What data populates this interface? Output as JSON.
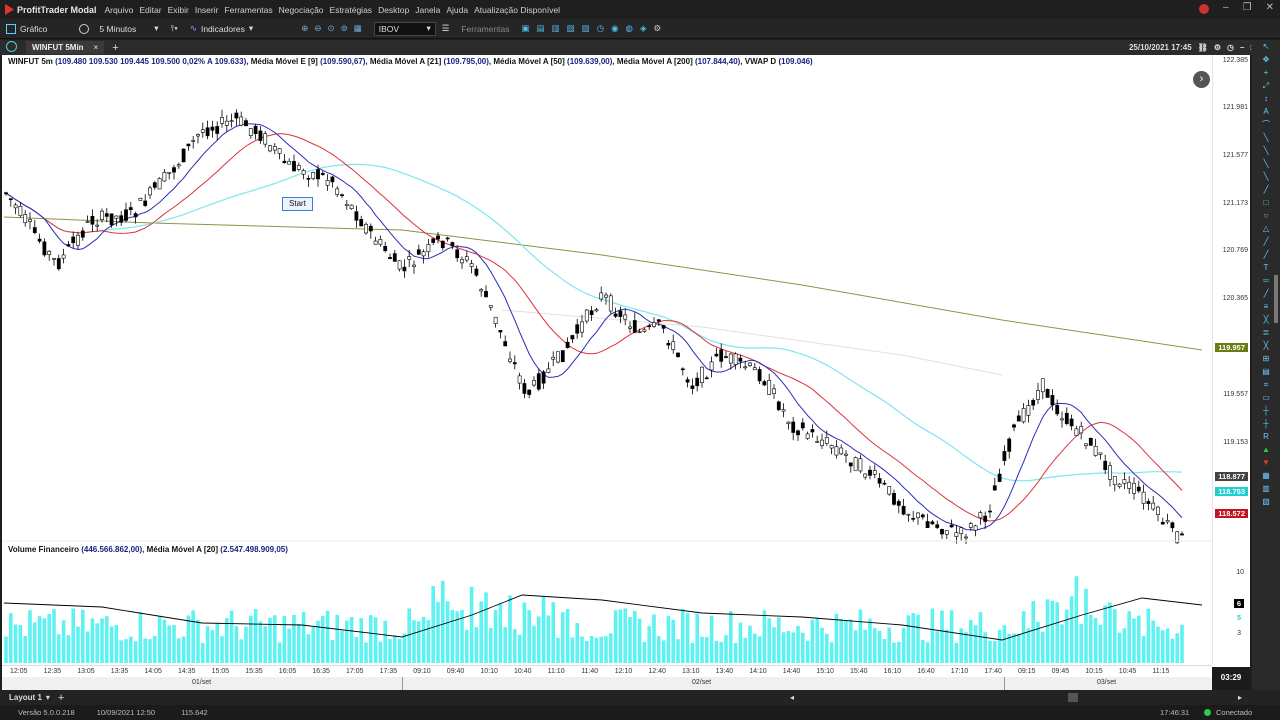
{
  "app": {
    "title": "ProfitTrader Modal",
    "menu": [
      "Arquivo",
      "Editar",
      "Exibir",
      "Inserir",
      "Ferramentas",
      "Negociação",
      "Estratégias",
      "Desktop",
      "Janela",
      "Ajuda",
      "Atualização Disponível"
    ]
  },
  "toolbar": {
    "chart_label": "Gráfico",
    "interval": "5 Minutos",
    "indicators_label": "Indicadores",
    "symbol": "IBOV",
    "tools_label": "Ferramentas"
  },
  "tab": {
    "name": "WINFUT 5Min",
    "datetime": "25/10/2021 17:45"
  },
  "chart": {
    "header": "WINFUT 5m",
    "quote": "(109.480  109.530  109.445  109.500  0,02%  A 109.633),",
    "indicators": [
      {
        "name": "Média Móvel E [9]",
        "value": "(109.590,67),"
      },
      {
        "name": "Média Móvel A [21]",
        "value": "(109.795,00),"
      },
      {
        "name": "Média Móvel A [50]",
        "value": "(109.639,00),"
      },
      {
        "name": "Média Móvel A [200]",
        "value": "(107.844,40),"
      },
      {
        "name": "VWAP D",
        "value": "(109.046)"
      }
    ],
    "volume_title": "Volume Financeiro",
    "volume_value": "(446.566.862,00),",
    "volume_ma": "Média Móvel A [20]",
    "volume_ma_value": "(2.547.498.909,05)",
    "start_label": "Start",
    "price_axis": [
      "122.385",
      "121.981",
      "121.577",
      "121.173",
      "120.769",
      "120.365",
      "119.957",
      "119.557",
      "119.153",
      "118.877",
      "118.753",
      "118.572"
    ],
    "volume_axis": [
      "10",
      "6",
      "5",
      "3"
    ],
    "time_axis": [
      "12:05",
      "12:35",
      "13:05",
      "13:35",
      "14:05",
      "14:35",
      "15:05",
      "15:35",
      "16:05",
      "16:35",
      "17:05",
      "17:35",
      "09:10",
      "09:40",
      "10:10",
      "10:40",
      "11:10",
      "11:40",
      "12:10",
      "12:40",
      "13:10",
      "13:40",
      "14:10",
      "14:40",
      "15:10",
      "15:40",
      "16:10",
      "16:40",
      "17:10",
      "17:40",
      "09:15",
      "09:45",
      "10:15",
      "10:45",
      "11:15"
    ],
    "date_axis": [
      "01/set",
      "02/set",
      "03/set"
    ],
    "countdown": "03:29",
    "tag_colors": {
      "olive": "#6b7a12",
      "gray": "#444444",
      "cyan": "#22cfcf",
      "red": "#c0151f",
      "black": "#000000"
    }
  },
  "status": {
    "layout": "Layout 1",
    "version": "Versão 5.0.0.218",
    "date": "10/09/2021 12:50",
    "value": "115.642",
    "clock": "17:46:31",
    "connection": "Conectado"
  }
}
